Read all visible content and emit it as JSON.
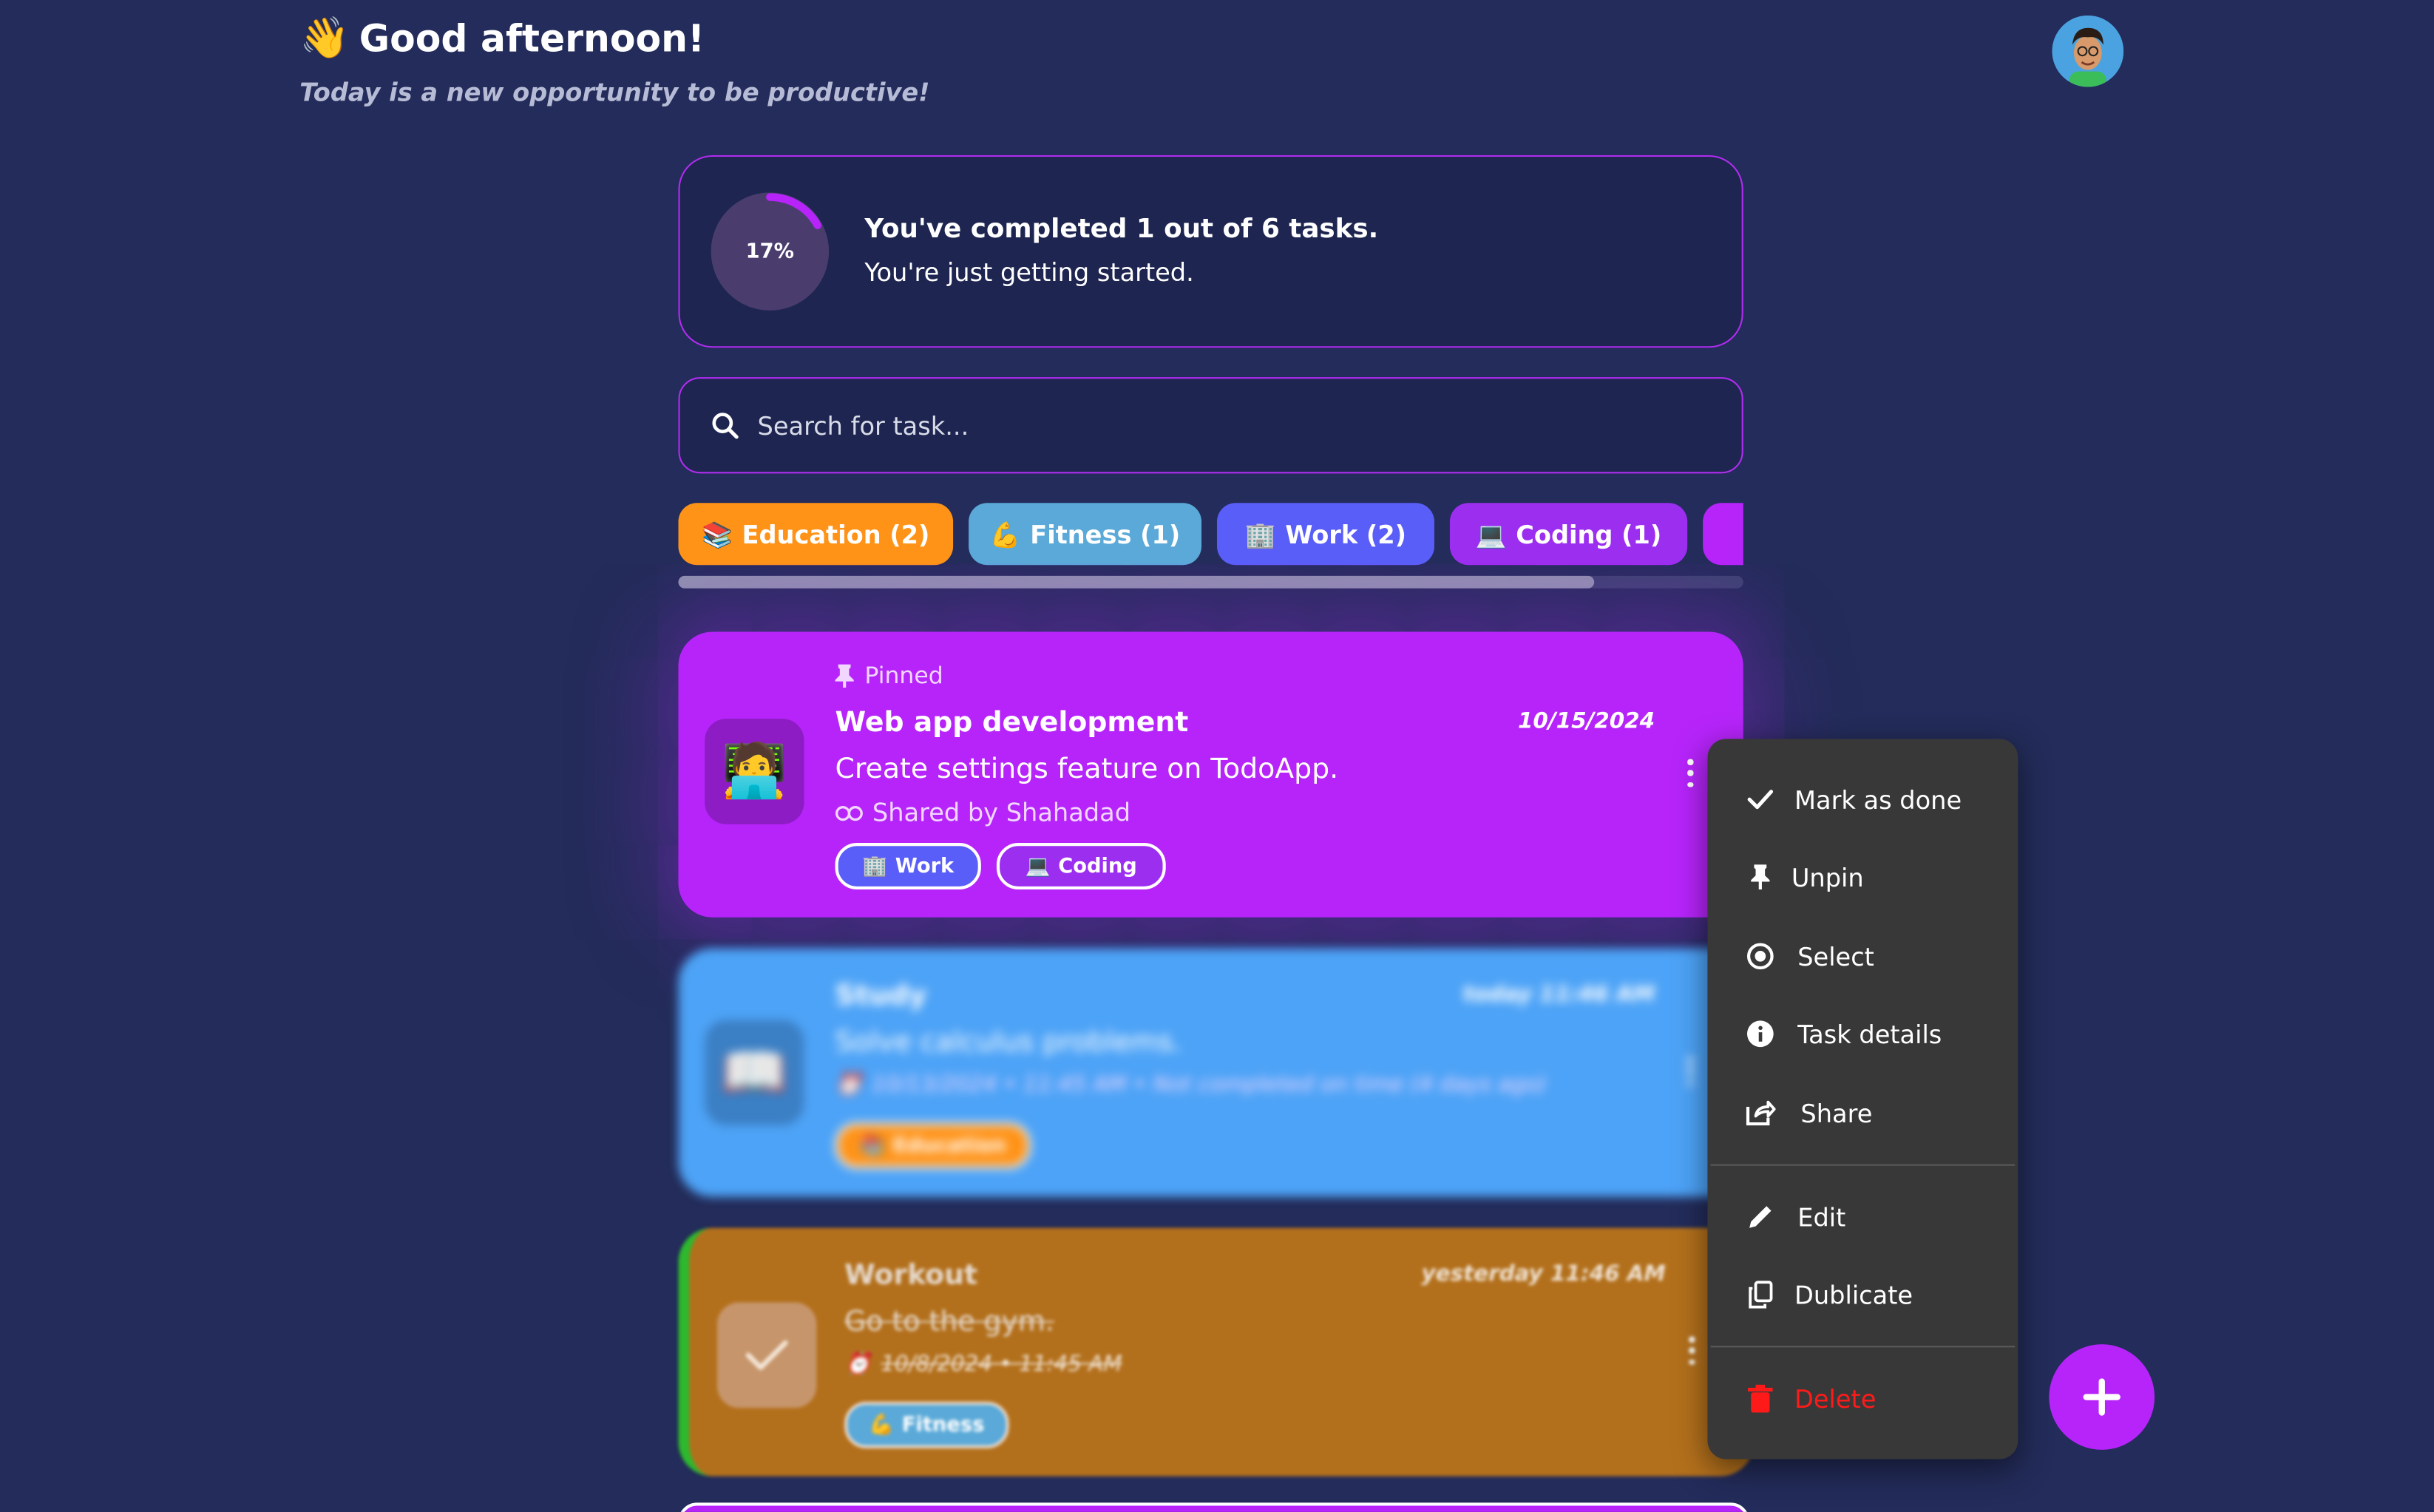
{
  "header": {
    "wave_emoji": "👋",
    "greeting": "Good afternoon!",
    "subtitle": "Today is a new opportunity to be productive!"
  },
  "progress": {
    "percent_label": "17%",
    "fraction": 0.17,
    "title": "You've completed 1 out of 6 tasks.",
    "message": "You're just getting started."
  },
  "search": {
    "placeholder": "Search for task..."
  },
  "categories": [
    {
      "emoji": "📚",
      "label": "Education (2)",
      "color": "#ff9318"
    },
    {
      "emoji": "💪",
      "label": "Fitness (1)",
      "color": "#5aa9d8"
    },
    {
      "emoji": "🏢",
      "label": "Work (2)",
      "color": "#5a5ef8"
    },
    {
      "emoji": "💻",
      "label": "Coding (1)",
      "color": "#9c2ef0"
    },
    {
      "emoji": "",
      "label": "",
      "color": "#b624fa"
    }
  ],
  "tasks": [
    {
      "pinned_label": "Pinned",
      "emoji": "🧑‍💻",
      "title": "Web app development",
      "date": "10/15/2024",
      "description": "Create settings feature on TodoApp.",
      "shared": "Shared by Shahadad",
      "tags": [
        {
          "emoji": "🏢",
          "label": "Work"
        },
        {
          "emoji": "💻",
          "label": "Coding"
        }
      ],
      "color": "#b624fa"
    },
    {
      "emoji": "📖",
      "title": "Study",
      "date": "today 11:46 AM",
      "description": "Solve calculus problems.",
      "deadline": "10/13/2024 • 11:45 AM • Not completed on time (4 days ago)",
      "tags": [
        {
          "emoji": "📚",
          "label": "Education"
        }
      ],
      "color": "#4da3f7"
    },
    {
      "title": "Workout",
      "date": "yesterday 11:46 AM",
      "description": "Go to the gym.",
      "deadline": "10/8/2024 • 11:45 AM",
      "tags": [
        {
          "emoji": "💪",
          "label": "Fitness"
        }
      ],
      "color": "#b3701c",
      "done": true
    }
  ],
  "menu": {
    "items": [
      {
        "label": "Mark as done",
        "icon": "check-icon"
      },
      {
        "label": "Unpin",
        "icon": "pin-icon"
      },
      {
        "label": "Select",
        "icon": "radio-icon"
      },
      {
        "label": "Task details",
        "icon": "info-icon"
      },
      {
        "label": "Share",
        "icon": "share-icon"
      },
      {
        "label": "Edit",
        "icon": "pencil-icon"
      },
      {
        "label": "Dublicate",
        "icon": "copy-icon"
      },
      {
        "label": "Delete",
        "icon": "trash-icon",
        "color": "#ff1a1a"
      }
    ]
  },
  "fab": {
    "icon": "plus-icon"
  }
}
